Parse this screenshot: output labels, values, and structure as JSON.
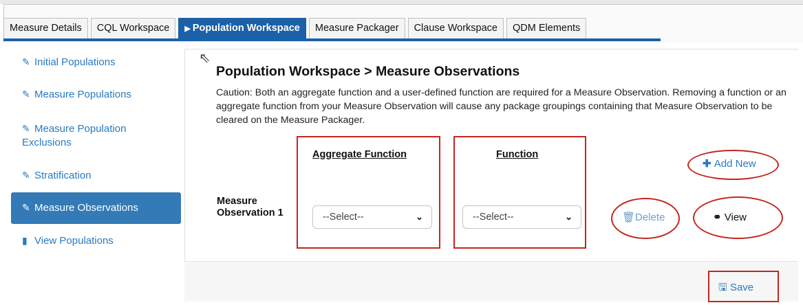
{
  "tabs": [
    {
      "label": "Measure Details"
    },
    {
      "label": "CQL Workspace"
    },
    {
      "label": "Population Workspace",
      "active": true
    },
    {
      "label": "Measure Packager"
    },
    {
      "label": "Clause Workspace"
    },
    {
      "label": "QDM Elements"
    }
  ],
  "active_tab_marker": "▶",
  "sidebar": {
    "items": [
      {
        "label": "Initial Populations",
        "icon": "pencil-icon"
      },
      {
        "label": "Measure Populations",
        "icon": "pencil-icon"
      },
      {
        "label": "Measure Population Exclusions",
        "icon": "pencil-icon"
      },
      {
        "label": "Stratification",
        "icon": "pencil-icon"
      },
      {
        "label": "Measure Observations",
        "icon": "pencil-icon",
        "active": true
      },
      {
        "label": "View Populations",
        "icon": "book-icon"
      }
    ]
  },
  "main": {
    "title": "Population Workspace > Measure Observations",
    "caution": "Caution: Both an aggregate function and a user-defined function are required for a Measure Observation. Removing a function or an aggregate function from your Measure Observation will cause any package groupings containing that Measure Observation to be cleared on the Measure Packager.",
    "aggregate_header": "Aggregate Function",
    "function_header": "Function",
    "row_label": "Measure Observation 1",
    "aggregate_select_value": "--Select--",
    "function_select_value": "--Select--",
    "add_new_label": "Add New",
    "delete_label": "Delete",
    "view_label": "View",
    "save_label": "Save"
  },
  "colors": {
    "accent": "#1a61a8",
    "link": "#2a7ac0",
    "active_sidebar": "#337ab7",
    "annotation_red": "#c3261e"
  }
}
